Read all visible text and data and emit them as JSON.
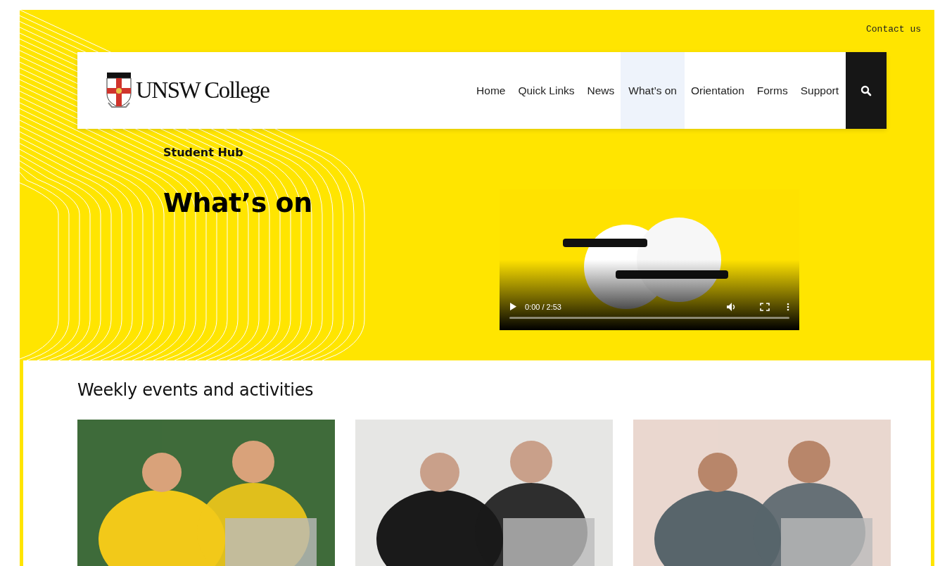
{
  "top_link": "Contact us",
  "header": {
    "logo_text": "UNSW College",
    "nav": [
      {
        "label": "Home",
        "selected": false
      },
      {
        "label": "Quick Links",
        "selected": false
      },
      {
        "label": "News",
        "selected": false
      },
      {
        "label": "What’s on",
        "selected": true
      },
      {
        "label": "Orientation",
        "selected": false
      },
      {
        "label": "Forms",
        "selected": false
      },
      {
        "label": "Support",
        "selected": false
      }
    ]
  },
  "hero": {
    "breadcrumb": "Student Hub",
    "title": "What’s on",
    "video": {
      "kind": "picture",
      "time": "0:00 / 2:53",
      "playing": false
    }
  },
  "events": {
    "heading": "Weekly events and activities"
  }
}
